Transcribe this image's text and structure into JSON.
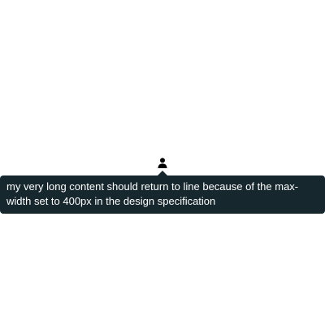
{
  "trigger": {
    "icon": "user-icon"
  },
  "tooltip": {
    "text": "my very long content should return to line because of the max-width set to 400px in the design specification",
    "background_color": "#17272e",
    "text_color": "#ffffff"
  }
}
